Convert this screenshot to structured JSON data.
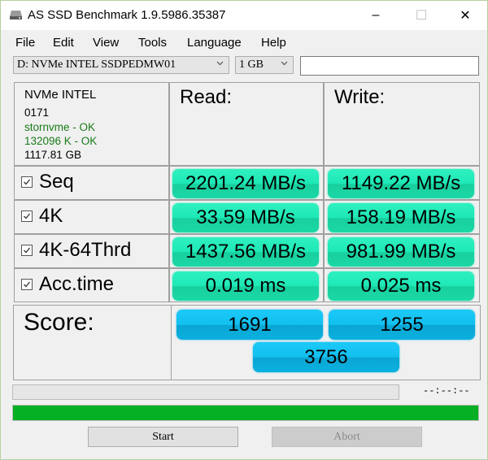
{
  "window": {
    "title": "AS SSD Benchmark 1.9.5986.35387",
    "controls": {
      "minimize": "–",
      "maximize": "☐",
      "close": "✕"
    }
  },
  "menu": [
    "File",
    "Edit",
    "View",
    "Tools",
    "Language",
    "Help"
  ],
  "toolbar": {
    "drive_select": "D: NVMe INTEL SSDPEDMW01",
    "size_select": "1 GB",
    "text_field_value": ""
  },
  "drive_info": {
    "model": "NVMe INTEL",
    "firmware": "0171",
    "driver_status": "stornvme - OK",
    "alignment_status": "132096 K - OK",
    "capacity": "1117.81 GB",
    "ok_color": "#1a7a1a"
  },
  "headers": {
    "read": "Read:",
    "write": "Write:"
  },
  "tests": [
    {
      "label": "Seq",
      "checked": true,
      "read": "2201.24 MB/s",
      "write": "1149.22 MB/s"
    },
    {
      "label": "4K",
      "checked": true,
      "read": "33.59 MB/s",
      "write": "158.19 MB/s"
    },
    {
      "label": "4K-64Thrd",
      "checked": true,
      "read": "1437.56 MB/s",
      "write": "981.99 MB/s"
    },
    {
      "label": "Acc.time",
      "checked": true,
      "read": "0.019 ms",
      "write": "0.025 ms"
    }
  ],
  "score": {
    "label": "Score:",
    "read": "1691",
    "write": "1255",
    "total": "3756"
  },
  "progress": {
    "elapsed": "--:--:--",
    "current_test_fraction": 0,
    "overall_fraction": 1.0,
    "fill_color": "#06b025"
  },
  "buttons": {
    "start": "Start",
    "abort": "Abort"
  },
  "colors": {
    "result_green": "#1ee8b6",
    "score_blue": "#12c0f0"
  }
}
